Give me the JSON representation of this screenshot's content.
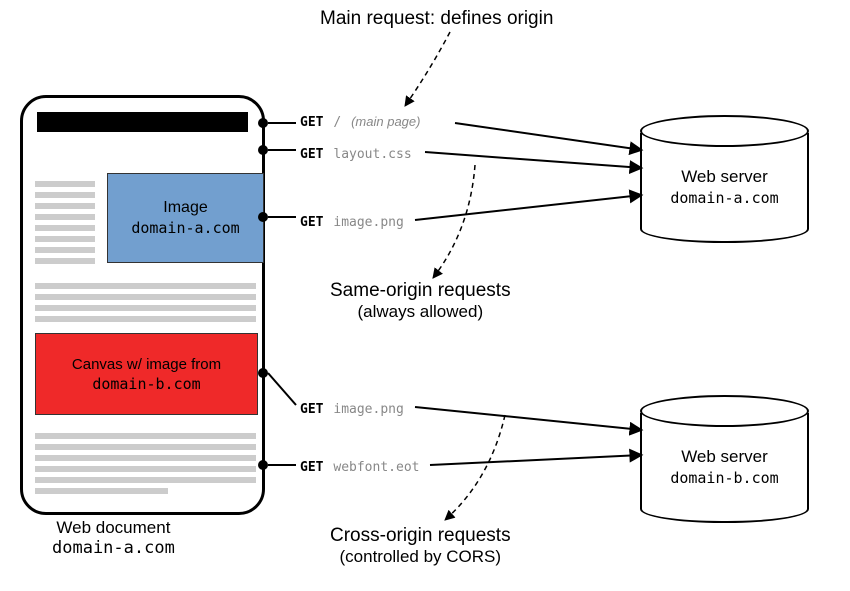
{
  "title_top": "Main request: defines origin",
  "doc": {
    "image_label": "Image",
    "image_domain": "domain-a.com",
    "canvas_label": "Canvas w/ image from",
    "canvas_domain": "domain-b.com",
    "caption_label": "Web document",
    "caption_domain": "domain-a.com"
  },
  "requests": [
    {
      "method": "GET",
      "path": "/",
      "note": "(main page)"
    },
    {
      "method": "GET",
      "path": "layout.css",
      "note": ""
    },
    {
      "method": "GET",
      "path": "image.png",
      "note": ""
    },
    {
      "method": "GET",
      "path": "image.png",
      "note": ""
    },
    {
      "method": "GET",
      "path": "webfont.eot",
      "note": ""
    }
  ],
  "same_origin": {
    "l1": "Same-origin requests",
    "l2": "(always allowed)"
  },
  "cross_origin": {
    "l1": "Cross-origin requests",
    "l2": "(controlled by CORS)"
  },
  "server_a": {
    "label": "Web server",
    "domain": "domain-a.com"
  },
  "server_b": {
    "label": "Web server",
    "domain": "domain-b.com"
  }
}
